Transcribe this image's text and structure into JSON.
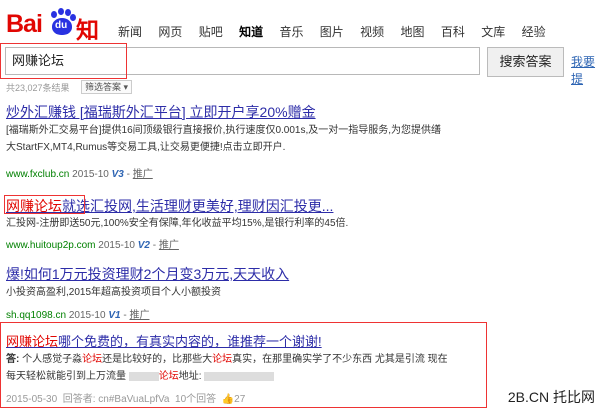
{
  "logo": {
    "bai": "Bai",
    "du": "du",
    "zhidao": "知道"
  },
  "nav": [
    "新闻",
    "网页",
    "贴吧",
    "知道",
    "音乐",
    "图片",
    "视频",
    "地图",
    "百科",
    "文库",
    "经验"
  ],
  "search": {
    "value": "网赚论坛",
    "button": "搜索答案",
    "ask": "我要提"
  },
  "filter": {
    "count": "共23,027条结果",
    "label": "筛选答案"
  },
  "results": [
    {
      "title": "炒外汇赚钱 [福瑞斯外汇平台] 立即开户享20%赠金",
      "desc1": "[福瑞斯外汇交易平台]提供16间顶级银行直接报价,执行速度仅0.001s,及一对一指导服务,为您提供缮",
      "desc2": "大StartFX,MT4,Rumus等交易工具,让交易更便捷!点击立即开户.",
      "url": "www.fxclub.cn",
      "date": "2015-10",
      "v": "V3",
      "ad": "推广"
    },
    {
      "title_em": "网赚论坛",
      "title_rest": "就选汇投网,生活理财更美好,理财因汇投更...",
      "desc1": "汇投网-注册即送50元,100%安全有保障,年化收益平均15%,是银行利率的45倍.",
      "url": "www.huitoup2p.com",
      "date": "2015-10",
      "v": "V2",
      "ad": "推广"
    },
    {
      "title": "爆!如何1万元投资理财2个月变3万元,天天收入",
      "desc1": "小投资高盈利,2015年超高投资项目个人小额投资",
      "url": "sh.qq1098.cn",
      "date": "2015-10",
      "v": "V1",
      "ad": "推广"
    },
    {
      "title_em": "网赚论坛",
      "title_rest": "哪个免费的，有真实内容的，谁推荐一个谢谢!",
      "a_label": "答:",
      "desc1_a": "个人感觉子淼",
      "desc1_em1": "论坛",
      "desc1_b": "还是比较好的，比那些大",
      "desc1_em2": "论坛",
      "desc1_c": "真实，在那里确实学了不少东西 尤其是引流 现在",
      "desc2_a": "每天轻松就能引到上万流量",
      "desc2_em": "论坛",
      "desc2_b": "地址:",
      "meta_date": "2015-05-30",
      "meta_answerer": "回答者: cn#BaVuaLpfVa",
      "meta_answers": "10个回答",
      "meta_likes": "27"
    }
  ],
  "watermark": "2B.CN 托比网"
}
